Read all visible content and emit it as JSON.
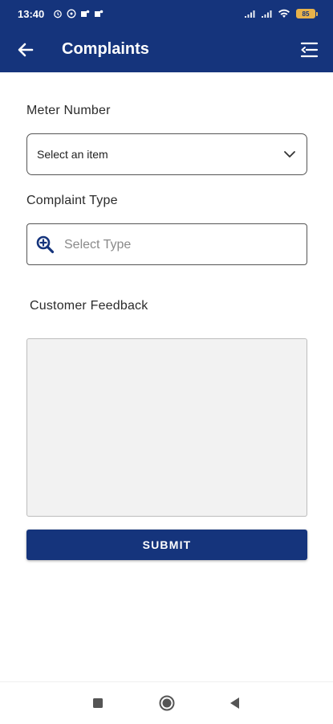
{
  "status_bar": {
    "time": "13:40",
    "battery": "85",
    "icons": [
      "alarm-icon",
      "whatsapp-icon",
      "teams-icon",
      "teams-icon",
      "signal-icon",
      "signal-icon",
      "wifi-icon",
      "battery-icon"
    ]
  },
  "app_bar": {
    "title": "Complaints",
    "back_icon": "arrow-left-icon",
    "menu_icon": "menu-icon"
  },
  "form": {
    "meter_number": {
      "label": "Meter Number",
      "selected": "Select an item"
    },
    "complaint_type": {
      "label": "Complaint Type",
      "placeholder": "Select Type"
    },
    "customer_feedback": {
      "label": "Customer Feedback",
      "value": ""
    },
    "submit_label": "SUBMIT"
  },
  "colors": {
    "primary": "#15347c",
    "feedback_bg": "#f2f2f2"
  },
  "nav_bar": {
    "icons": [
      "recents-square-icon",
      "home-circle-icon",
      "back-triangle-icon"
    ]
  }
}
